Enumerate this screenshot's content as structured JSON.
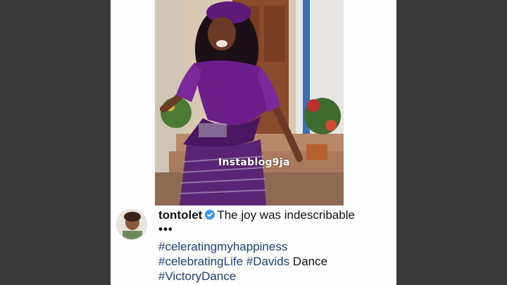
{
  "post": {
    "watermark": "Instablog9ja",
    "username": "tontolet",
    "caption": "The joy was indescribable",
    "more": "•••",
    "hashtag_line1": "#celeratingmyhappiness",
    "hashtag_line2_tag1": "#celebratingLife",
    "hashtag_line2_tag2": "#Davids",
    "hashtag_line2_text": "Dance",
    "hashtag_line3": "#VictoryDance"
  },
  "colors": {
    "background": "#3a3a3a",
    "panel": "#fdfdfd",
    "hashtag": "#1f3f73",
    "verified": "#3897f0",
    "dress": "#6b1f8a"
  },
  "icons": [
    "verified-badge-icon"
  ]
}
